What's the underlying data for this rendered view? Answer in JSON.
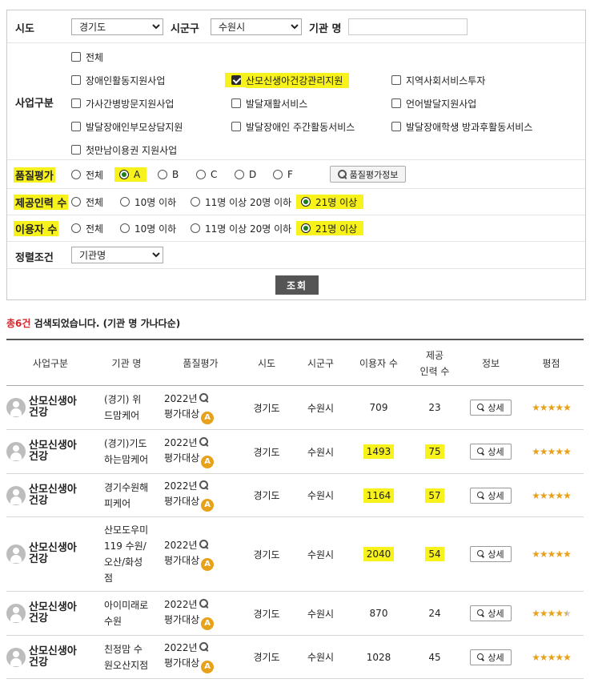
{
  "filters": {
    "sido": {
      "label": "시도",
      "value": "경기도"
    },
    "sigungu": {
      "label": "시군구",
      "value": "수원시"
    },
    "org_name": {
      "label": "기관 명",
      "value": ""
    },
    "business": {
      "label": "사업구분",
      "items": [
        {
          "label": "전체",
          "checked": false
        },
        {
          "label": "장애인활동지원사업",
          "checked": false
        },
        {
          "label": "산모신생아건강관리지원",
          "checked": true
        },
        {
          "label": "지역사회서비스투자",
          "checked": false
        },
        {
          "label": "가사간병방문지원사업",
          "checked": false
        },
        {
          "label": "발달재활서비스",
          "checked": false
        },
        {
          "label": "언어발달지원사업",
          "checked": false
        },
        {
          "label": "발달장애인부모상담지원",
          "checked": false
        },
        {
          "label": "발달장애인 주간활동서비스",
          "checked": false
        },
        {
          "label": "발달장애학생 방과후활동서비스",
          "checked": false
        },
        {
          "label": "첫만남이용권 지원사업",
          "checked": false
        }
      ]
    },
    "quality": {
      "label": "품질평가",
      "options": [
        "전체",
        "A",
        "B",
        "C",
        "D",
        "F"
      ],
      "selected": "A",
      "button": "품질평가정보"
    },
    "staff": {
      "label": "제공인력 수",
      "options": [
        "전체",
        "10명 이하",
        "11명 이상 20명 이하",
        "21명 이상"
      ],
      "selected": "21명 이상"
    },
    "users": {
      "label": "이용자 수",
      "options": [
        "전체",
        "10명 이하",
        "11명 이상 20명 이하",
        "21명 이상"
      ],
      "selected": "21명 이상"
    },
    "sort": {
      "label": "정렬조건",
      "value": "기관명"
    },
    "search_button": "조회"
  },
  "result": {
    "count": "총6건",
    "suffix": "검색되었습니다. (기관 명 가나다순)"
  },
  "table": {
    "headers": [
      "사업구분",
      "기관 명",
      "품질평가",
      "시도",
      "시군구",
      "이용자 수",
      "제공\n인력 수",
      "정보",
      "평점"
    ],
    "detail_label": "상세",
    "rows": [
      {
        "category": "산모신생아\n건강",
        "org": "(경기) 위\n드맘케어",
        "quality_year": "2022년",
        "quality_text": "평가대상",
        "grade": "A",
        "sido": "경기도",
        "sigungu": "수원시",
        "users": "709",
        "staff": "23",
        "stars": 5,
        "hl_users": false,
        "hl_staff": false
      },
      {
        "category": "산모신생아\n건강",
        "org": "(경기)기도\n하는맘케어",
        "quality_year": "2022년",
        "quality_text": "평가대상",
        "grade": "A",
        "sido": "경기도",
        "sigungu": "수원시",
        "users": "1493",
        "staff": "75",
        "stars": 5,
        "hl_users": true,
        "hl_staff": true
      },
      {
        "category": "산모신생아\n건강",
        "org": "경기수원해\n피케어",
        "quality_year": "2022년",
        "quality_text": "평가대상",
        "grade": "A",
        "sido": "경기도",
        "sigungu": "수원시",
        "users": "1164",
        "staff": "57",
        "stars": 5,
        "hl_users": true,
        "hl_staff": true
      },
      {
        "category": "산모신생아\n건강",
        "org": "산모도우미\n119 수원/\n오산/화성\n점",
        "quality_year": "2022년",
        "quality_text": "평가대상",
        "grade": "A",
        "sido": "경기도",
        "sigungu": "수원시",
        "users": "2040",
        "staff": "54",
        "stars": 5,
        "hl_users": true,
        "hl_staff": true
      },
      {
        "category": "산모신생아\n건강",
        "org": "아이미래로\n수원",
        "quality_year": "2022년",
        "quality_text": "평가대상",
        "grade": "A",
        "sido": "경기도",
        "sigungu": "수원시",
        "users": "870",
        "staff": "24",
        "stars": 4.5,
        "hl_users": false,
        "hl_staff": false
      },
      {
        "category": "산모신생아\n건강",
        "org": "친정맘 수\n원오산지점",
        "quality_year": "2022년",
        "quality_text": "평가대상",
        "grade": "A",
        "sido": "경기도",
        "sigungu": "수원시",
        "users": "1028",
        "staff": "45",
        "stars": 5,
        "hl_users": false,
        "hl_staff": false
      }
    ]
  }
}
